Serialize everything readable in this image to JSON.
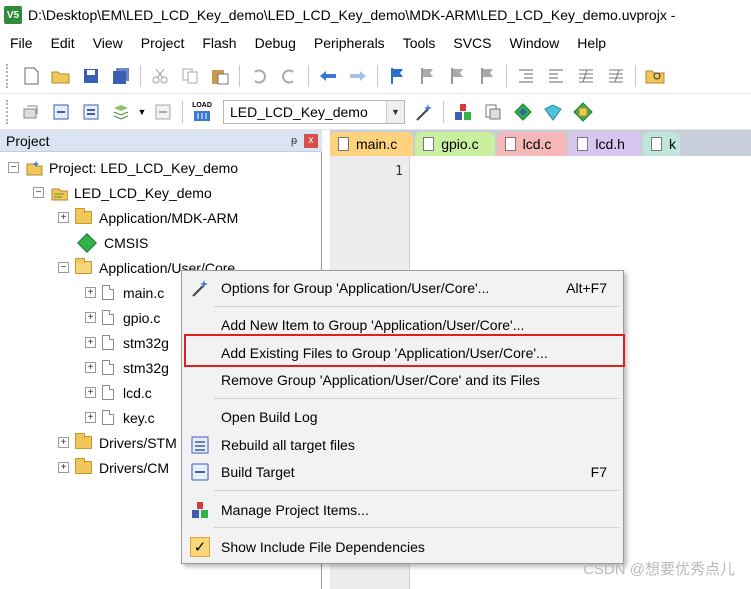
{
  "window": {
    "title": "D:\\Desktop\\EM\\LED_LCD_Key_demo\\LED_LCD_Key_demo\\MDK-ARM\\LED_LCD_Key_demo.uvprojx -",
    "app_icon": "V5"
  },
  "menubar": {
    "items": [
      "File",
      "Edit",
      "View",
      "Project",
      "Flash",
      "Debug",
      "Peripherals",
      "Tools",
      "SVCS",
      "Window",
      "Help"
    ]
  },
  "toolbar2": {
    "target_value": "LED_LCD_Key_demo",
    "load_label": "LOAD"
  },
  "project_panel": {
    "title": "Project",
    "pin_symbol": "ᵽ",
    "close_symbol": "x",
    "tree": {
      "root_label": "Project: LED_LCD_Key_demo",
      "target_label": "LED_LCD_Key_demo",
      "groups": [
        {
          "label": "Application/MDK-ARM"
        },
        {
          "label": "CMSIS"
        },
        {
          "label": "Application/User/Core"
        },
        {
          "label": "Drivers/STM"
        },
        {
          "label": "Drivers/CM"
        }
      ],
      "files": [
        "main.c",
        "gpio.c",
        "stm32g",
        "stm32g",
        "lcd.c",
        "key.c"
      ]
    }
  },
  "editor": {
    "tabs": [
      {
        "label": "main.c",
        "active": true
      },
      {
        "label": "gpio.c"
      },
      {
        "label": "lcd.c"
      },
      {
        "label": "lcd.h"
      },
      {
        "label": "k"
      }
    ],
    "line_numbers": [
      "1"
    ]
  },
  "context_menu": {
    "items": {
      "options": {
        "label": "Options for Group 'Application/User/Core'...",
        "shortcut": "Alt+F7",
        "icon": "wand-icon"
      },
      "add_new": {
        "label": "Add New  Item to Group 'Application/User/Core'..."
      },
      "add_existing": {
        "label": "Add Existing Files to Group 'Application/User/Core'...",
        "highlighted": true
      },
      "remove": {
        "label": "Remove Group 'Application/User/Core' and its Files"
      },
      "open_log": {
        "label": "Open Build Log"
      },
      "rebuild": {
        "label": "Rebuild all target files",
        "icon": "rebuild-icon"
      },
      "build": {
        "label": "Build Target",
        "shortcut": "F7",
        "icon": "build-icon"
      },
      "manage": {
        "label": "Manage Project Items...",
        "icon": "manage-items-icon"
      },
      "show_deps": {
        "label": "Show Include File Dependencies",
        "icon": "check-icon",
        "checked": true,
        "check_glyph": "✓"
      }
    }
  },
  "watermark": "CSDN @想要优秀点儿",
  "colors": {
    "highlight_border": "#e0201b",
    "panel_header": "#dbe4f3",
    "tab_main": "#ffd27f",
    "tab_gpio": "#c9f0a0",
    "tab_lcdc": "#f5b7b7",
    "tab_lcdh": "#d6c6f0"
  }
}
